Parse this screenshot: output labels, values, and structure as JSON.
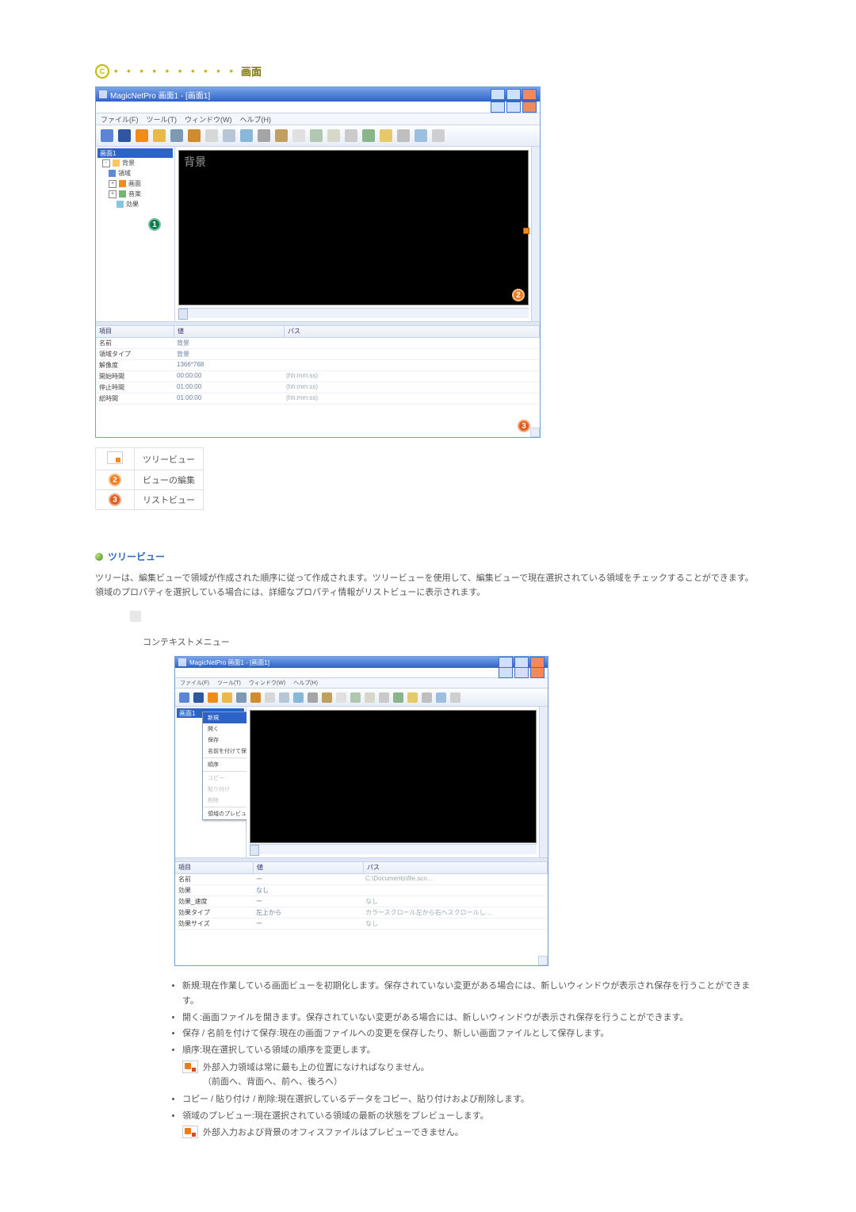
{
  "section": {
    "marker": "C",
    "dots": "• • • • • • • • • •",
    "title": "画面"
  },
  "win": {
    "title": "MagicNetPro 画面1 - [画面1]",
    "menus": [
      "ファイル(F)",
      "ツール(T)",
      "ウィンドウ(W)",
      "ヘルプ(H)"
    ],
    "tree_header": "画面1",
    "tree": [
      {
        "label": "背景",
        "lv": 0,
        "ic": "folder"
      },
      {
        "label": "領域",
        "lv": 1,
        "ic": "blue"
      },
      {
        "label": "画面",
        "lv": 1,
        "ic": "orange"
      },
      {
        "label": "音楽",
        "lv": 1,
        "ic": "green"
      },
      {
        "label": "効果",
        "lv": 1,
        "ic": "cyan"
      }
    ],
    "bg_label": "背景",
    "list_headers": [
      "項目",
      "値",
      "パス"
    ],
    "list_rows": [
      {
        "a": "名前",
        "b": "背景",
        "c": ""
      },
      {
        "a": "領域タイプ",
        "b": "背景",
        "c": ""
      },
      {
        "a": "解像度",
        "b": "1366*768",
        "c": ""
      },
      {
        "a": "開始時間",
        "b": "00:00:00",
        "c": "(hh:mm:ss)"
      },
      {
        "a": "停止時間",
        "b": "01:00:00",
        "c": "(hh:mm:ss)"
      },
      {
        "a": "総時間",
        "b": "01:00:00",
        "c": "(hh:mm:ss)"
      }
    ]
  },
  "badges": {
    "b1": "1",
    "b2": "2",
    "b3": "3"
  },
  "legend": {
    "r1": "ツリービュー",
    "r2": "ビューの編集",
    "r3": "リストビュー"
  },
  "sub": {
    "title": "ツリービュー",
    "body": "ツリーは、編集ビューで領域が作成された順序に従って作成されます。ツリービューを使用して、編集ビューで現在選択されている領域をチェックすることができます。領域のプロパティを選択している場合には、詳細なプロパティ情報がリストビューに表示されます。",
    "ctx_title": "コンテキストメニュー"
  },
  "win2": {
    "title": "MagicNetPro 画面1 - [画面1]",
    "menus": [
      "ファイル(F)",
      "ツール(T)",
      "ウィンドウ(W)",
      "ヘルプ(H)"
    ],
    "ctx": {
      "sel": "新規",
      "items": [
        "開く",
        "保存",
        "名前を付けて保存"
      ],
      "order_label": "順序",
      "disabled": [
        "コピー",
        "貼り付け",
        "削除"
      ],
      "preview": "領域のプレビュー"
    },
    "list_headers": [
      "項目",
      "値",
      "パス"
    ],
    "list_rows": [
      {
        "a": "名前",
        "b": "ー",
        "c": "C:\\Documents\\file.scn…"
      },
      {
        "a": "効果",
        "b": "なし",
        "c": ""
      },
      {
        "a": "効果_速度",
        "b": "ー",
        "c": "なし"
      },
      {
        "a": "効果タイプ",
        "b": "左上から",
        "c": "カラースクロール左から右へスクロールし…"
      },
      {
        "a": "効果サイズ",
        "b": "ー",
        "c": "なし"
      }
    ]
  },
  "bullets": {
    "b1a": "新規:現在作業している画面ビューを初期化します。保存されていない変更がある場合には、新しいウィンドウが表示され保存を行うことができます。",
    "b2a": "開く:画面ファイルを開きます。保存されていない変更がある場合には、新しいウィンドウが表示され保存を行うことができます。",
    "b3a": "保存 / 名前を付けて保存:現在の画面ファイルへの変更を保存したり、新しい画面ファイルとして保存します。",
    "b4a": "順序:現在選択している領域の順序を変更します。",
    "b4warn1": "外部入力領域は常に最も上の位置になければなりません。",
    "b4warn2": "（前面へ、背面へ、前へ、後ろへ）",
    "b5a": "コピー / 貼り付け / 削除:現在選択しているデータをコピー、貼り付けおよび削除します。",
    "b6a": "領域のプレビュー:現在選択されている領域の最新の状態をプレビューします。",
    "b6warn": "外部入力および背景のオフィスファイルはプレビューできません。"
  }
}
